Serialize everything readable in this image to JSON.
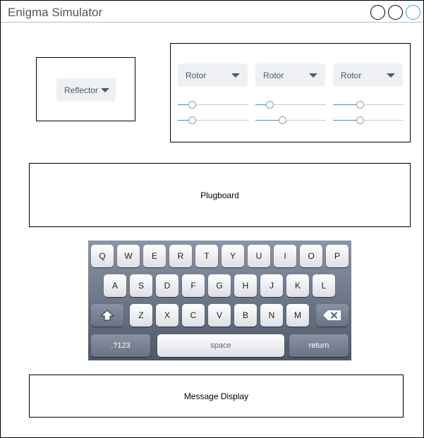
{
  "window": {
    "title": "Enigma Simulator"
  },
  "reflector": {
    "label": "Reflector"
  },
  "rotors": [
    {
      "label": "Rotor",
      "ring": 0.2,
      "position": 0.2
    },
    {
      "label": "Rotor",
      "ring": 0.2,
      "position": 0.38
    },
    {
      "label": "Rotor",
      "ring": 0.38,
      "position": 0.38
    }
  ],
  "plugboard": {
    "label": "Plugboard"
  },
  "keyboard": {
    "row1": [
      "Q",
      "W",
      "E",
      "R",
      "T",
      "Y",
      "U",
      "I",
      "O",
      "P"
    ],
    "row2": [
      "A",
      "S",
      "D",
      "F",
      "G",
      "H",
      "J",
      "K",
      "L"
    ],
    "row3": [
      "Z",
      "X",
      "C",
      "V",
      "B",
      "N",
      "M"
    ],
    "numbers_label": ".?123",
    "space_label": "space",
    "return_label": "return"
  },
  "message_display": {
    "label": "Message Display"
  },
  "icons": {
    "close": "circle-button-icon",
    "minimize": "circle-button-icon",
    "maximize": "circle-button-icon",
    "dropdown": "caret-down-icon",
    "shift": "shift-arrow-icon",
    "backspace": "backspace-icon"
  },
  "colors": {
    "accent": "#29a9e0",
    "slider_fill": "#3a8fd6",
    "dropdown_bg": "#eef0f4",
    "dropdown_text": "#4a5a70",
    "keyboard_bg_top": "#8a95a6",
    "keyboard_bg_bottom": "#4e5869"
  }
}
